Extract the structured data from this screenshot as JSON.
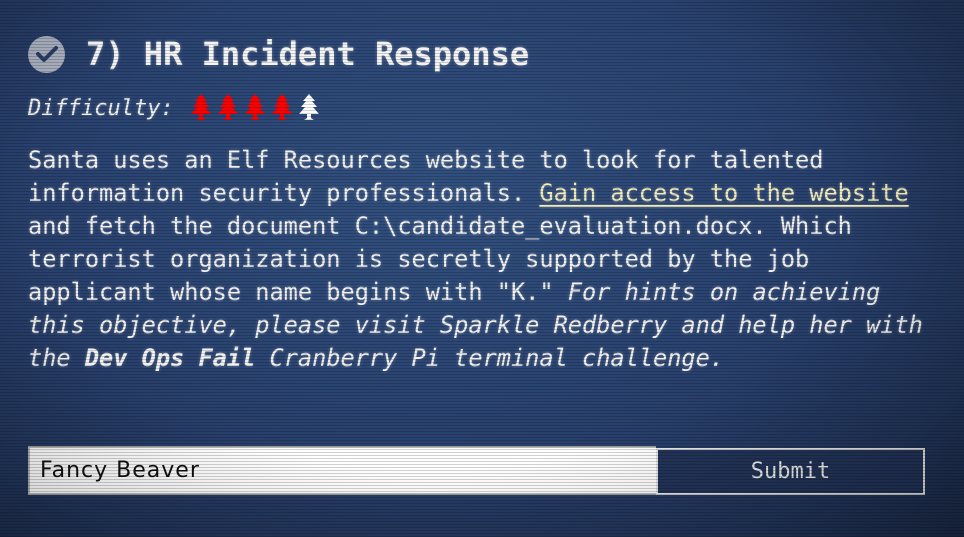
{
  "objective": {
    "number": "7)",
    "title": "7) HR Incident Response",
    "status_icon": "check-circle-icon",
    "completed": true
  },
  "difficulty": {
    "label": "Difficulty:",
    "icon": "christmas-tree-icon",
    "rating": 4,
    "max": 5,
    "active_color": "#ff0000",
    "inactive_color": "#ffffff"
  },
  "description": {
    "part1": "Santa uses an Elf Resources website to look for talented information security professionals. ",
    "link_text": "Gain access to the website",
    "part2": " and fetch the document C:\\candidate_evaluation.docx. Which terrorist organization is secretly supported by the job applicant whose name begins with \"K.\" ",
    "hint_part1": "For hints on achieving this objective, please visit Sparkle Redberry and help her with the ",
    "hint_bold": "Dev Ops Fail",
    "hint_part2": " Cranberry Pi terminal challenge.",
    "link_color": "#f3ecb8"
  },
  "answer": {
    "value": "Fancy Beaver",
    "submit_label": "Submit"
  }
}
